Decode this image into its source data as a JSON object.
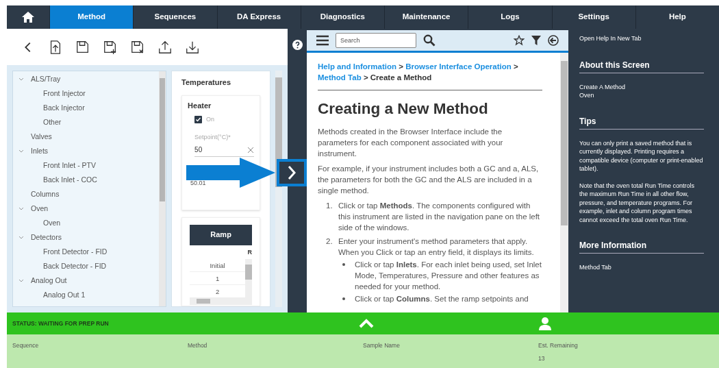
{
  "nav": {
    "tabs": [
      {
        "label": "Method",
        "selected": true
      },
      {
        "label": "Sequences",
        "selected": false
      },
      {
        "label": "DA Express",
        "selected": false
      },
      {
        "label": "Diagnostics",
        "selected": false
      },
      {
        "label": "Maintenance",
        "selected": false
      },
      {
        "label": "Logs",
        "selected": false
      },
      {
        "label": "Settings",
        "selected": false
      },
      {
        "label": "Help",
        "selected": false
      }
    ]
  },
  "tree": [
    {
      "label": "ALS/Tray",
      "expanded": true,
      "children": [
        {
          "label": "Front Injector"
        },
        {
          "label": "Back Injector"
        },
        {
          "label": "Other"
        }
      ]
    },
    {
      "label": "Valves"
    },
    {
      "label": "Inlets",
      "expanded": true,
      "children": [
        {
          "label": "Front Inlet - PTV"
        },
        {
          "label": "Back Inlet - COC"
        }
      ]
    },
    {
      "label": "Columns"
    },
    {
      "label": "Oven",
      "expanded": true,
      "children": [
        {
          "label": "Oven"
        }
      ]
    },
    {
      "label": "Detectors",
      "expanded": true,
      "children": [
        {
          "label": "Front Detector - FID"
        },
        {
          "label": "Back Detector - FID"
        }
      ]
    },
    {
      "label": "Analog Out",
      "expanded": true,
      "children": [
        {
          "label": "Analog Out 1"
        }
      ]
    }
  ],
  "temperatures": {
    "title": "Temperatures",
    "heater": {
      "title": "Heater",
      "on": {
        "label": "On",
        "checked": true
      },
      "setpoint": {
        "label": "Setpoint(°C)*",
        "value": "50"
      },
      "actual": "50.01"
    },
    "ramp_table": {
      "header": "Ramp",
      "column_2": "R",
      "rows": [
        "Initial",
        "1",
        "2"
      ]
    }
  },
  "help": {
    "search": {
      "placeholder": "Search"
    },
    "breadcrumb": [
      {
        "kind": "link",
        "text": "Help and Information"
      },
      {
        "kind": "sep",
        "text": ">"
      },
      {
        "kind": "link",
        "text": "Browser Interface Operation"
      },
      {
        "kind": "sep",
        "text": ">"
      },
      {
        "kind": "link",
        "text": "Method Tab"
      },
      {
        "kind": "sep",
        "text": ">"
      },
      {
        "kind": "current",
        "text": "Create a Method"
      }
    ],
    "title": "Creating a New Method",
    "paragraphs": [
      "Methods created in the Browser Interface include the parameters for each component associated with your instrument.",
      "For example, if your instrument includes both a GC and a, ALS, the parameters for both the GC and the ALS are included in a single method."
    ],
    "steps": [
      {
        "number": "1.",
        "text": "Click or tap **Methods**. The components configured with this instrument are listed in the navigation pane on the left side of the windows."
      },
      {
        "number": "2.",
        "text": "Enter your instrument's method parameters that apply. When you Click or tap an entry field, it displays its limits.",
        "bullets": [
          "Click or tap **Inlets**. For each inlet being used, set Inlet Mode, Temperatures, Pressure and other features as needed for your method.",
          "Click or tap **Columns**. Set the ramp setpoints and"
        ]
      }
    ]
  },
  "side": {
    "open_link": "Open Help In New Tab",
    "sections": [
      {
        "heading": "About this Screen",
        "paragraphs": [
          "Create A Method\nOven"
        ]
      },
      {
        "heading": "Tips",
        "paragraphs": [
          "You can only print a saved method that is currently displayed. Printing requires a compatible device (computer or print-enabled tablet).",
          "Note that the oven total Run Time controls the maximum Run Time in all other flow, pressure, and temperature programs. For example, inlet and column program times cannot exceed the total oven Run Time."
        ]
      },
      {
        "heading": "More Information",
        "paragraphs": [
          "Method Tab"
        ]
      }
    ]
  },
  "status": {
    "text": "STATUS: WAITING FOR PREP RUN",
    "columns": [
      {
        "label": "Sequence"
      },
      {
        "label": "Method"
      },
      {
        "label": "Sample Name"
      },
      {
        "label": "Est. Remaining",
        "value": "13"
      }
    ]
  }
}
